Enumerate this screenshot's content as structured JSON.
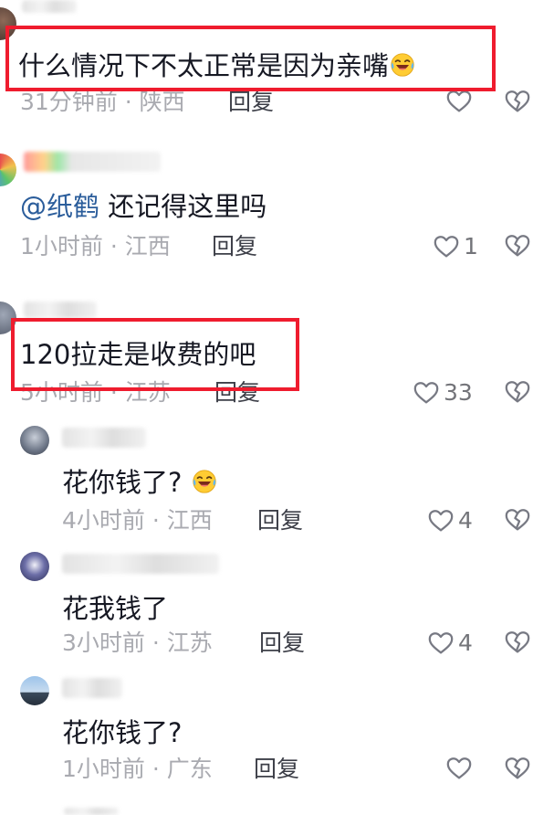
{
  "icons": {
    "like": "heart-outline-icon",
    "dislike": "broken-heart-outline-icon",
    "emoji": "laughing-tears-emoji-icon"
  },
  "colors": {
    "highlight": "#ef1c2e",
    "mention": "#2b5d9b",
    "meta": "#a9aab0"
  },
  "comments": [
    {
      "text": "什么情况下不太正常是因为亲嘴",
      "time": "31分钟前",
      "location": "陕西",
      "reply": "回复",
      "likes": "",
      "highlighted": true
    },
    {
      "mention": "@纸鹤",
      "text": "还记得这里吗",
      "time": "1小时前",
      "location": "江西",
      "reply": "回复",
      "likes": "1",
      "highlighted": false
    },
    {
      "text": "120拉走是收费的吧",
      "time": "5小时前",
      "location": "江苏",
      "reply": "回复",
      "likes": "33",
      "highlighted": true
    }
  ],
  "replies": [
    {
      "text": "花你钱了?",
      "time": "4小时前",
      "location": "江西",
      "reply": "回复",
      "likes": "4"
    },
    {
      "text": "花我钱了",
      "time": "3小时前",
      "location": "江苏",
      "reply": "回复",
      "likes": "4"
    },
    {
      "text": "花你钱了?",
      "time": "1小时前",
      "location": "广东",
      "reply": "回复",
      "likes": ""
    }
  ]
}
